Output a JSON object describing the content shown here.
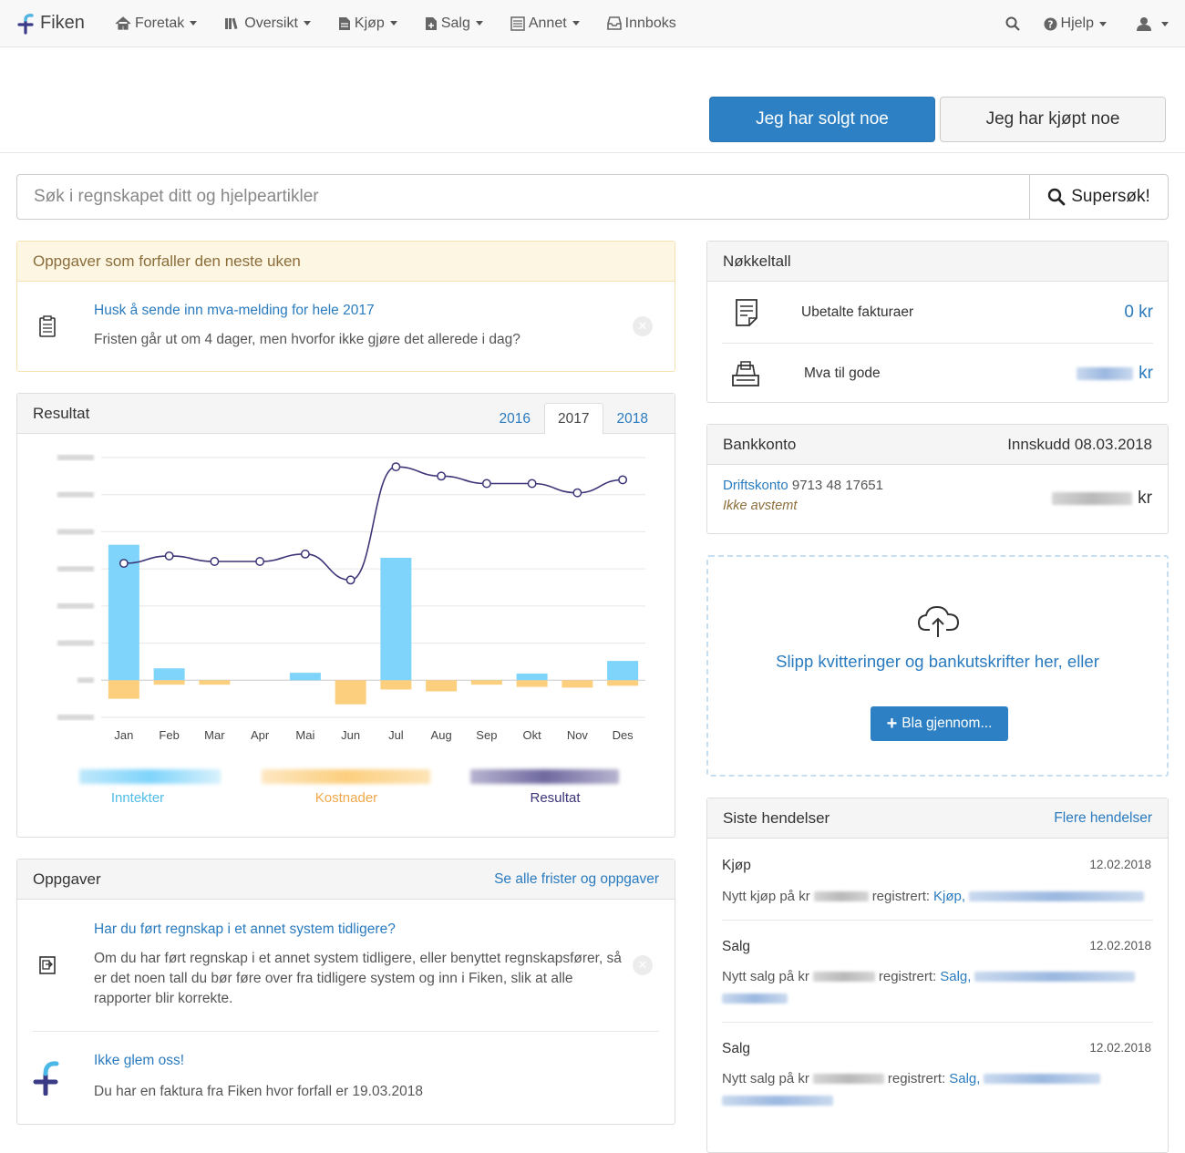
{
  "nav": {
    "brand": "Fiken",
    "items": [
      {
        "label": "Foretak",
        "icon": "home-icon"
      },
      {
        "label": "Oversikt",
        "icon": "books-icon"
      },
      {
        "label": "Kjøp",
        "icon": "document-icon"
      },
      {
        "label": "Salg",
        "icon": "document-plus-icon"
      },
      {
        "label": "Annet",
        "icon": "ledger-icon"
      },
      {
        "label": "Innboks",
        "icon": "inbox-icon"
      }
    ],
    "help_label": "Hjelp"
  },
  "header": {
    "sold_label": "Jeg har solgt noe",
    "bought_label": "Jeg har kjøpt noe"
  },
  "search": {
    "placeholder": "Søk i regnskapet ditt og hjelpeartikler",
    "button_label": "Supersøk!"
  },
  "upcoming": {
    "title": "Oppgaver som forfaller den neste uken",
    "task_title": "Husk å sende inn mva-melding for hele 2017",
    "task_text": "Fristen går ut om 4 dager, men hvorfor ikke gjøre det allerede i dag?"
  },
  "resultat": {
    "title": "Resultat",
    "tabs": [
      "2016",
      "2017",
      "2018"
    ],
    "active_tab": "2017",
    "legend": {
      "income": "Inntekter",
      "costs": "Kostnader",
      "result": "Resultat"
    }
  },
  "chart_data": {
    "type": "bar",
    "categories": [
      "Jan",
      "Feb",
      "Mar",
      "Apr",
      "Mai",
      "Jun",
      "Jul",
      "Aug",
      "Sep",
      "Okt",
      "Nov",
      "Des"
    ],
    "series": [
      {
        "name": "Inntekter",
        "type": "bar",
        "values": [
          3.65,
          0.32,
          0,
          0,
          0.2,
          0,
          3.3,
          0,
          0,
          0.18,
          0,
          0.52
        ]
      },
      {
        "name": "Kostnader",
        "type": "bar",
        "values": [
          -0.5,
          -0.12,
          -0.12,
          0,
          0,
          -0.65,
          -0.25,
          -0.3,
          -0.12,
          -0.18,
          -0.2,
          -0.15
        ]
      },
      {
        "name": "Resultat",
        "type": "line",
        "values": [
          3.15,
          3.35,
          3.2,
          3.2,
          3.4,
          2.7,
          5.75,
          5.5,
          5.3,
          5.3,
          5.05,
          5.4
        ]
      }
    ],
    "ylim": [
      -1,
      6
    ],
    "ytick_count": 8,
    "y_tick_labels_obscured": true,
    "colors": {
      "income": "#7fd4fb",
      "costs": "#fccf7e",
      "result": "#3c3577"
    }
  },
  "tasks": {
    "title": "Oppgaver",
    "link": "Se alle frister og oppgaver",
    "items": [
      {
        "title": "Har du ført regnskap i et annet system tidligere?",
        "text": "Om du har ført regnskap i et annet system tidligere, eller benyttet regnskapsfører, så er det noen tall du bør føre over fra tidligere system og inn i Fiken, slik at alle rapporter blir korrekte."
      },
      {
        "title": "Ikke glem oss!",
        "text": "Du har en faktura fra Fiken hvor forfall er 19.03.2018"
      }
    ]
  },
  "keyfigures": {
    "title": "Nøkkeltall",
    "unpaid_label": "Ubetalte fakturaer",
    "unpaid_value": "0 kr",
    "vat_label": "Mva til gode",
    "currency": "kr"
  },
  "bank": {
    "title": "Bankkonto",
    "deposit_label": "Innskudd 08.03.2018",
    "account_name": "Driftskonto",
    "account_number": "9713 48 17651",
    "status": "Ikke avstemt",
    "currency": "kr"
  },
  "dropzone": {
    "text": "Slipp kvitteringer og bankutskrifter her, eller",
    "button": "Bla gjennom..."
  },
  "events": {
    "title": "Siste hendelser",
    "link": "Flere hendelser",
    "items": [
      {
        "type": "Kjøp",
        "date": "12.02.2018",
        "prefix": "Nytt kjøp på kr",
        "middle": "registrert:",
        "link": "Kjøp,"
      },
      {
        "type": "Salg",
        "date": "12.02.2018",
        "prefix": "Nytt salg på kr",
        "middle": "registrert:",
        "link": "Salg,"
      },
      {
        "type": "Salg",
        "date": "12.02.2018",
        "prefix": "Nytt salg på kr",
        "middle": "registrert:",
        "link": "Salg,"
      }
    ]
  },
  "colors": {
    "primary": "#2d80c3",
    "link": "#2a7bbf",
    "warning_heading": "#8a6d3b"
  }
}
